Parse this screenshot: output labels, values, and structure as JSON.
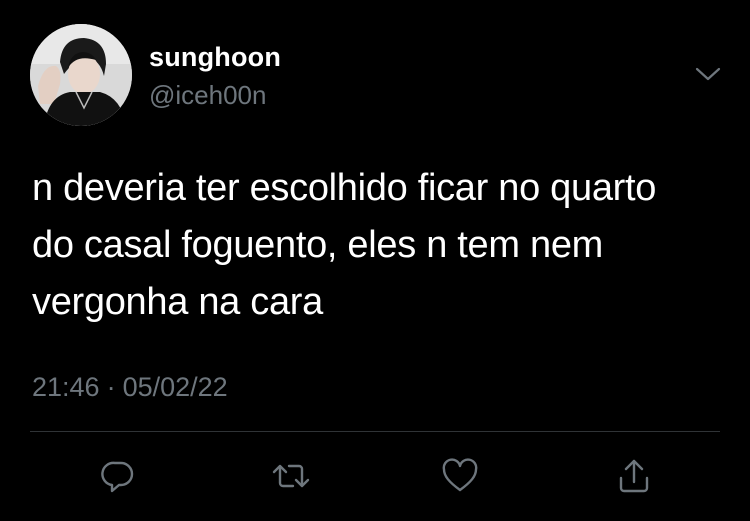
{
  "tweet": {
    "author": {
      "display_name": "sunghoon",
      "handle": "@iceh00n",
      "avatar_icon": "profile-photo"
    },
    "text_lines": [
      "n deveria ter escolhido ficar no quarto",
      "do casal foguento, eles n tem nem",
      "vergonha na cara"
    ],
    "time": "21:46",
    "separator": "·",
    "date": "05/02/22",
    "actions": [
      "reply-icon",
      "retweet-icon",
      "like-icon",
      "share-icon"
    ]
  },
  "colors": {
    "background": "#000000",
    "text_primary": "#ffffff",
    "text_secondary": "#6e767d",
    "icon": "#6e767d",
    "divider": "#2f3336"
  }
}
